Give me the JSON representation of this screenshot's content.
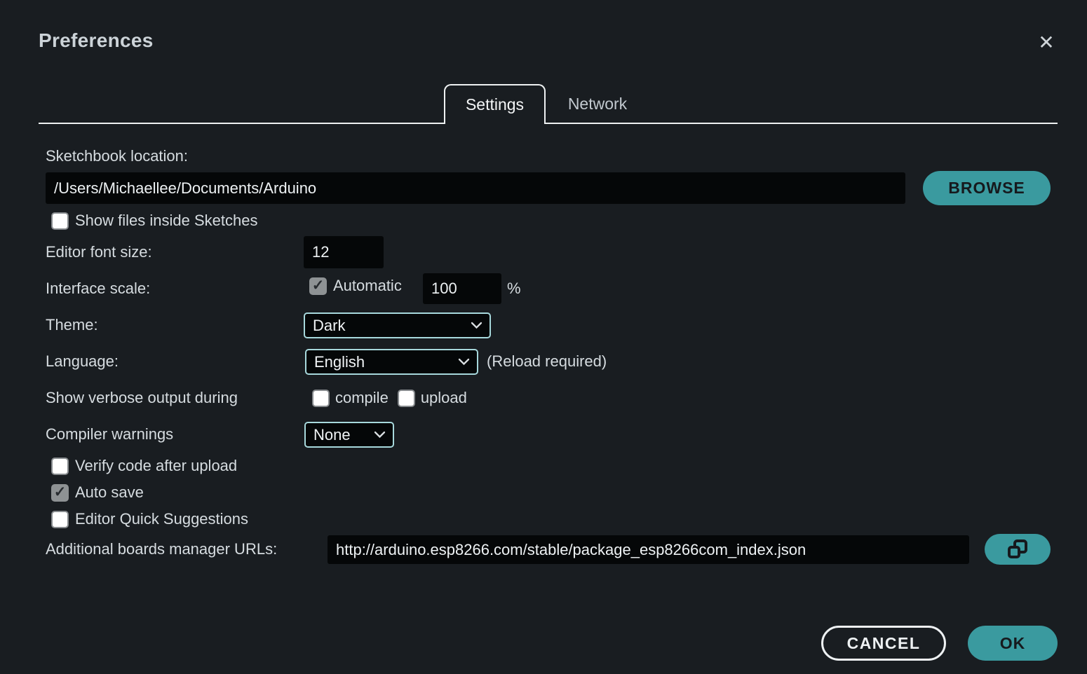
{
  "dialog": {
    "title": "Preferences",
    "close_glyph": "✕",
    "tabs": [
      {
        "label": "Settings",
        "active": true
      },
      {
        "label": "Network",
        "active": false
      }
    ]
  },
  "fields": {
    "sketchbook": {
      "label": "Sketchbook location:",
      "value": "/Users/Michaellee/Documents/Arduino",
      "browse_label": "BROWSE"
    },
    "show_files": {
      "label": "Show files inside Sketches",
      "checked": false
    },
    "editor_font_size": {
      "label": "Editor font size:",
      "value": "12"
    },
    "interface_scale": {
      "label": "Interface scale:",
      "auto_label": "Automatic",
      "auto_checked": true,
      "value": "100",
      "unit": "%"
    },
    "theme": {
      "label": "Theme:",
      "value": "Dark"
    },
    "language": {
      "label": "Language:",
      "value": "English",
      "note": "(Reload required)"
    },
    "verbose": {
      "label": "Show verbose output during",
      "compile_label": "compile",
      "compile_checked": false,
      "upload_label": "upload",
      "upload_checked": false
    },
    "compiler_warnings": {
      "label": "Compiler warnings",
      "value": "None"
    },
    "verify_code": {
      "label": "Verify code after upload",
      "checked": false
    },
    "auto_save": {
      "label": "Auto save",
      "checked": true
    },
    "quick_suggestions": {
      "label": "Editor Quick Suggestions",
      "checked": false
    },
    "boards_urls": {
      "label": "Additional boards manager URLs:",
      "value": "http://arduino.esp8266.com/stable/package_esp8266com_index.json"
    }
  },
  "actions": {
    "cancel_label": "CANCEL",
    "ok_label": "OK"
  },
  "icons": {
    "close": "close-icon",
    "chevron": "chevron-down-icon",
    "boards_button": "clone-window-icon"
  },
  "colors": {
    "accent_teal": "#3a9a9f",
    "dialog_bg": "#191d21",
    "input_bg": "#050708",
    "dropdown_border": "#a7d8dc",
    "tab_border": "#eef1f2",
    "label_text": "#d6dce0",
    "button_dark_text": "#16191d"
  }
}
